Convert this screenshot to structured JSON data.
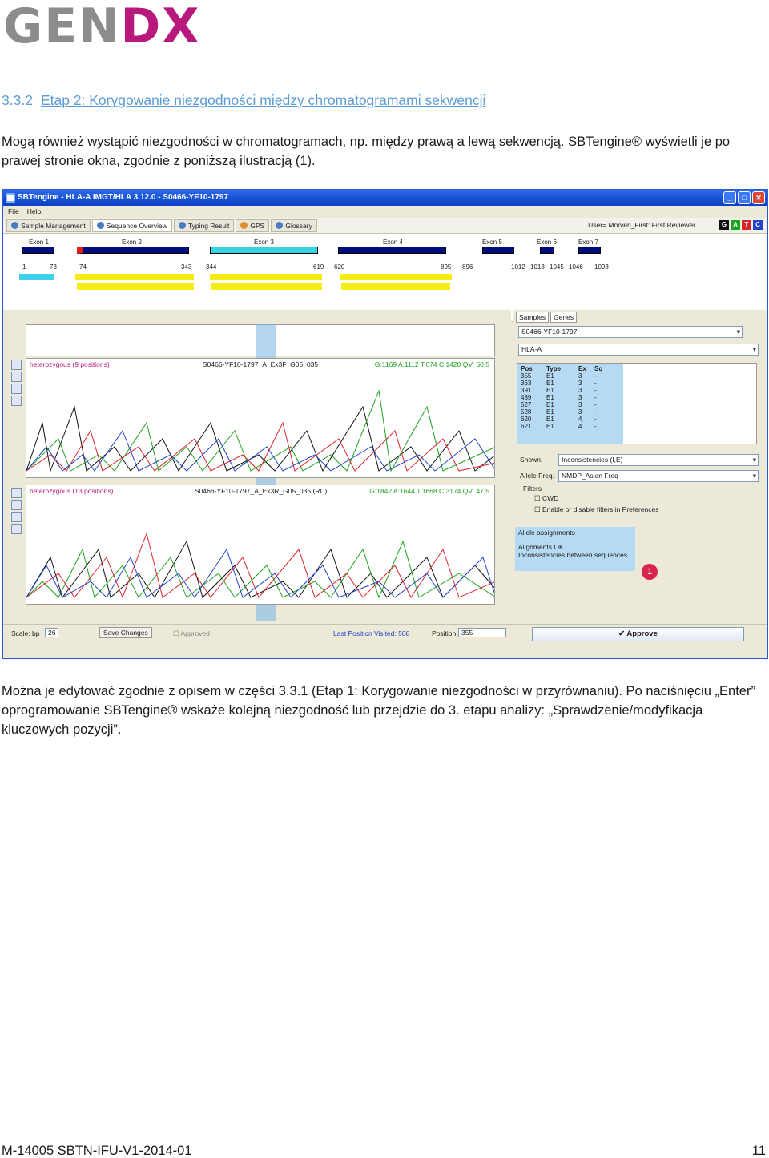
{
  "logo": {
    "gen": "GEN",
    "dx": "DX"
  },
  "heading": {
    "number": "3.3.2",
    "title": "Etap 2: Korygowanie niezgodności między chromatogramami sekwencji"
  },
  "paragraph1": "Mogą również wystąpić niezgodności w chromatogramach, np. między prawą a lewą sekwencją. SBTengine® wyświetli je po prawej stronie okna, zgodnie z poniższą ilustracją (1).",
  "paragraph2": "Można je edytować zgodnie z opisem w części 3.3.1 (Etap 1: Korygowanie niezgodności w przyrównaniu). Po naciśnięciu „Enter” oprogramowanie SBTengine® wskaże kolejną niezgodność lub przejdzie do 3. etapu analizy: „Sprawdzenie/modyfikacja kluczowych pozycji”.",
  "footer": {
    "doc": "M-14005 SBTN-IFU-V1-2014-01",
    "page": "11"
  },
  "app": {
    "title": "SBTengine - HLA-A IMGT/HLA 3.12.0 - S0466-YF10-1797",
    "menu": [
      "File",
      "Help"
    ],
    "tabs": [
      "Sample Management",
      "Sequence Overview",
      "Typing Result",
      "GPS",
      "Glossary"
    ],
    "user": "User= Morven_First: First Reviewer",
    "bases": [
      "G",
      "A",
      "T",
      "C"
    ],
    "exons": [
      "Exon 1",
      "Exon 2",
      "Exon 3",
      "Exon 4",
      "Exon 5",
      "Exon 6",
      "Exon 7"
    ],
    "positions": [
      "1",
      "73",
      "74",
      "343",
      "344",
      "619",
      "620",
      "895",
      "896",
      "1012",
      "1013",
      "1045",
      "1046",
      "1093"
    ],
    "chrom1": {
      "left": "heterozygous (9 positions)",
      "center": "S0466-YF10-1797_A_Ex3F_G05_035",
      "right": "G:1169 A:1112 T:674 C:1420 QV: 50,5"
    },
    "chrom2": {
      "left": "heterozygous (13 positions)",
      "center": "S0466-YF10-1797_A_Ex3R_G05_035 (RC)",
      "right": "G:1842 A:1644 T:1668 C:3174 QV: 47,5"
    },
    "right_tabs": [
      "Samples",
      "Genes"
    ],
    "sample": "S0466-YF10-1797",
    "locus": "HLA-A",
    "table_headers": [
      "Pos",
      "Type",
      "Ex",
      "Sq"
    ],
    "table_rows": [
      [
        "355",
        "E1",
        "3",
        "-"
      ],
      [
        "363",
        "E1",
        "3",
        "-"
      ],
      [
        "391",
        "E1",
        "3",
        "-"
      ],
      [
        "489",
        "E1",
        "3",
        "-"
      ],
      [
        "527",
        "E1",
        "3",
        "-"
      ],
      [
        "528",
        "E1",
        "3",
        "-"
      ],
      [
        "620",
        "E1",
        "4",
        "-"
      ],
      [
        "621",
        "E1",
        "4",
        "-"
      ]
    ],
    "shown_label": "Shown:",
    "shown_value": "Inconsistencies (I,E)",
    "allele_label": "Allele Freq.",
    "allele_value": "NMDP_Asian Freq",
    "filters": "Filters",
    "cwd": "CWD",
    "enable_filters": "Enable or disable filters in Preferences",
    "assign_title": "Allele assignments",
    "assign1": "Alignments OK",
    "assign2": "Inconsistencies between sequences",
    "badge": "1",
    "scale_label": "Scale: bp",
    "scale_value": "26",
    "save": "Save Changes",
    "approved": "Approved",
    "last_pos": "Last Position Visited: 508",
    "position_label": "Position",
    "position_value": "355",
    "approve": "Approve"
  }
}
